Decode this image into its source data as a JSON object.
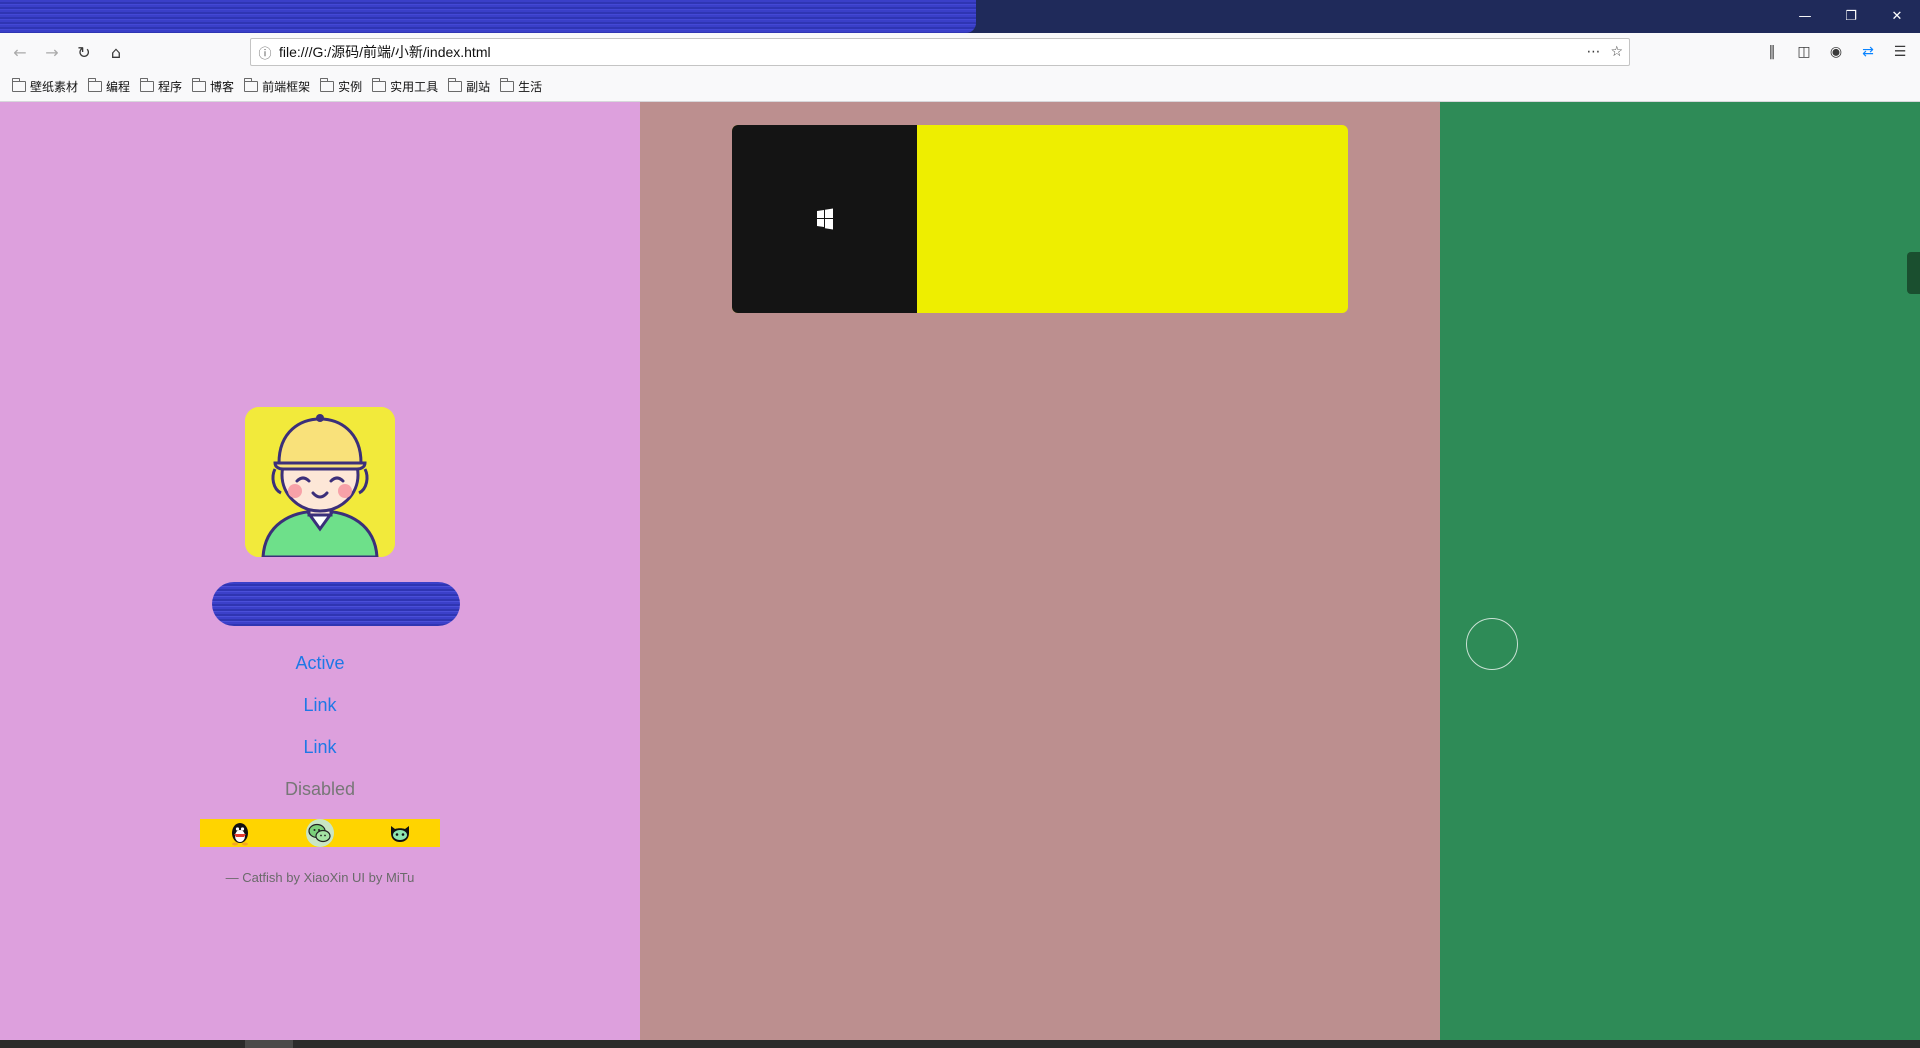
{
  "browser": {
    "url": "file:///G:/源码/前端/小新/index.html",
    "window_controls": {
      "minimize_icon": "minimize-icon",
      "restore_icon": "restore-icon",
      "close_icon": "close-icon"
    },
    "bookmarks": [
      {
        "label": "壁纸素材"
      },
      {
        "label": "编程"
      },
      {
        "label": "程序"
      },
      {
        "label": "博客"
      },
      {
        "label": "前端框架"
      },
      {
        "label": "实例"
      },
      {
        "label": "实用工具"
      },
      {
        "label": "副站"
      },
      {
        "label": "生活"
      }
    ]
  },
  "page": {
    "colors": {
      "left_pane": "#dda0dd",
      "middle_pane": "#bc8f8f",
      "right_pane": "#2e8b57",
      "card_accent": "#eeee00",
      "card_dark": "#141414",
      "social_bar": "#ffd400",
      "link": "#1e78e6"
    },
    "sidebar": {
      "nav": [
        {
          "label": "Active"
        },
        {
          "label": "Link"
        },
        {
          "label": "Link"
        },
        {
          "label": "Disabled"
        }
      ],
      "social_icons": [
        "qq-icon",
        "wechat-icon",
        "github-icon"
      ],
      "credit": "— Catfish by XiaoXin UI by MiTu"
    },
    "card": {
      "icon": "windows-icon"
    }
  }
}
